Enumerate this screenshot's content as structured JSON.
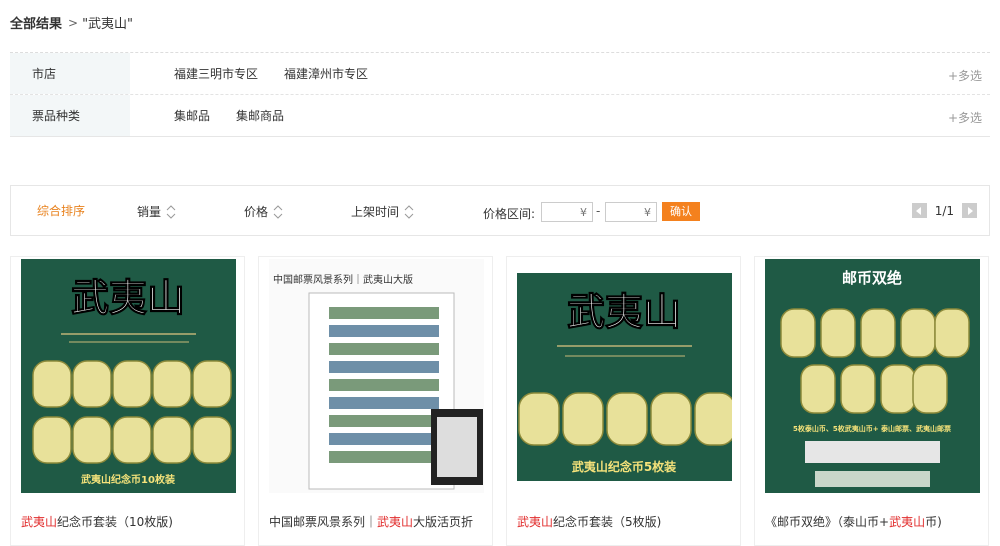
{
  "breadcrumb": {
    "root": "全部结果",
    "separator": ">",
    "query": "\"武夷山\""
  },
  "filters": [
    {
      "label": "市店",
      "options": [
        "福建三明市专区",
        "福建漳州市专区"
      ],
      "more": "+多选"
    },
    {
      "label": "票品种类",
      "options": [
        "集邮品",
        "集邮商品"
      ],
      "more": "+多选"
    }
  ],
  "sortbar": {
    "active": "综合排序",
    "items": [
      "销量",
      "价格",
      "上架时间"
    ],
    "price_range_label": "价格区间:",
    "price_min_placeholder": "¥",
    "price_max_placeholder": "¥",
    "price_dash": "-",
    "confirm": "确认",
    "page": "1/1"
  },
  "products": [
    {
      "title_hl": "武夷山",
      "title_rest": "纪念币套装（10枚版)",
      "img_caption": "武夷山纪念币10枚装",
      "img_heading": "武夷山"
    },
    {
      "title_pre": "中国邮票风景系列｜",
      "title_hl": "武夷山",
      "title_rest": "大版活页折",
      "img_caption": "中国邮票风景系列｜武夷山大版"
    },
    {
      "title_hl": "武夷山",
      "title_rest": "纪念币套装（5枚版)",
      "img_caption": "武夷山纪念币5枚装",
      "img_heading": "武夷山"
    },
    {
      "title_pre": "《邮币双绝》（泰山币+",
      "title_hl": "武夷山",
      "title_rest": "币)",
      "img_heading": "邮币双绝",
      "img_caption": "5枚泰山币、5枚武夷山币+ 泰山邮票、武夷山邮票"
    }
  ],
  "colors": {
    "accent": "#f4811e",
    "active_sort": "#e8821e",
    "highlight": "#e12d2d",
    "card_green": "#1f5a45",
    "label_bg": "#f3f7f8"
  }
}
